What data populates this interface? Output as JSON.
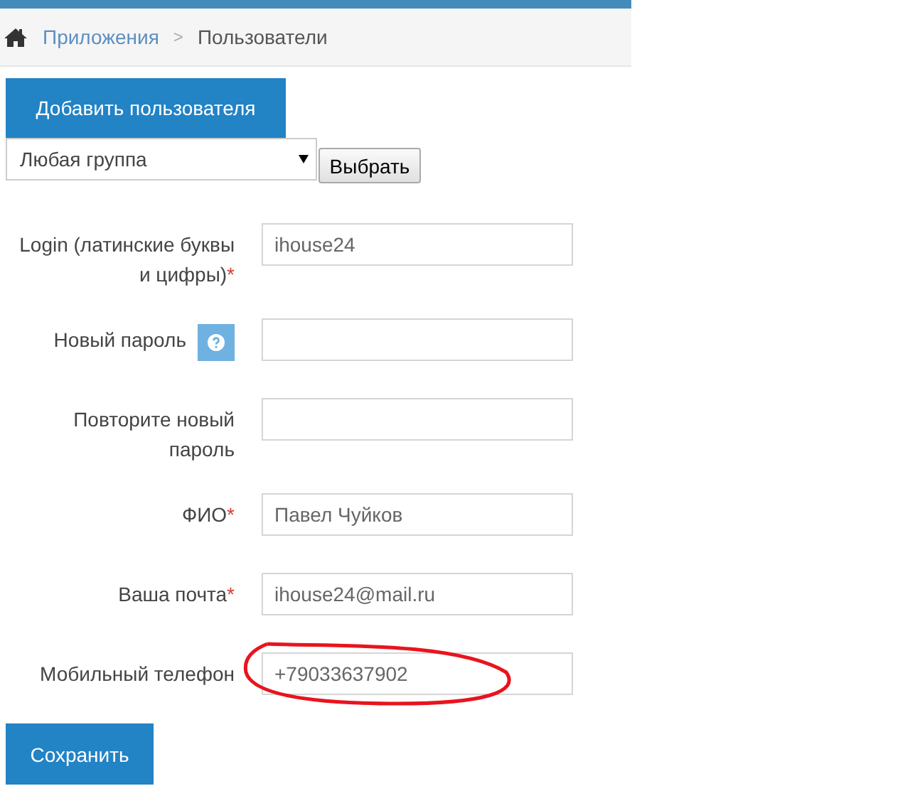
{
  "breadcrumb": {
    "items": [
      {
        "label": "Приложения"
      },
      {
        "label": "Пользователи"
      }
    ],
    "separator": ">"
  },
  "add_button": "Добавить пользователя",
  "group_filter": {
    "value": "Любая группа",
    "button": "Выбрать"
  },
  "fields": [
    {
      "label": "Login (латинские буквы и цифры)",
      "mark": "*",
      "value": "ihouse24",
      "help": false,
      "circled": false
    },
    {
      "label": "Новый пароль",
      "help": true,
      "circled": false
    },
    {
      "label": "Повторите новый пароль",
      "help": false,
      "circled": false
    },
    {
      "label": "ФИО",
      "mark": "*",
      "value": "Павел Чуйков",
      "help": false,
      "circled": false
    },
    {
      "label": "Ваша почта",
      "mark": "*",
      "value": "ihouse24@mail.ru",
      "help": false,
      "circled": false
    },
    {
      "label": "Мобильный телефон",
      "value": "+79033637902",
      "help": false,
      "circled": true
    }
  ],
  "save_button": "Сохранить"
}
